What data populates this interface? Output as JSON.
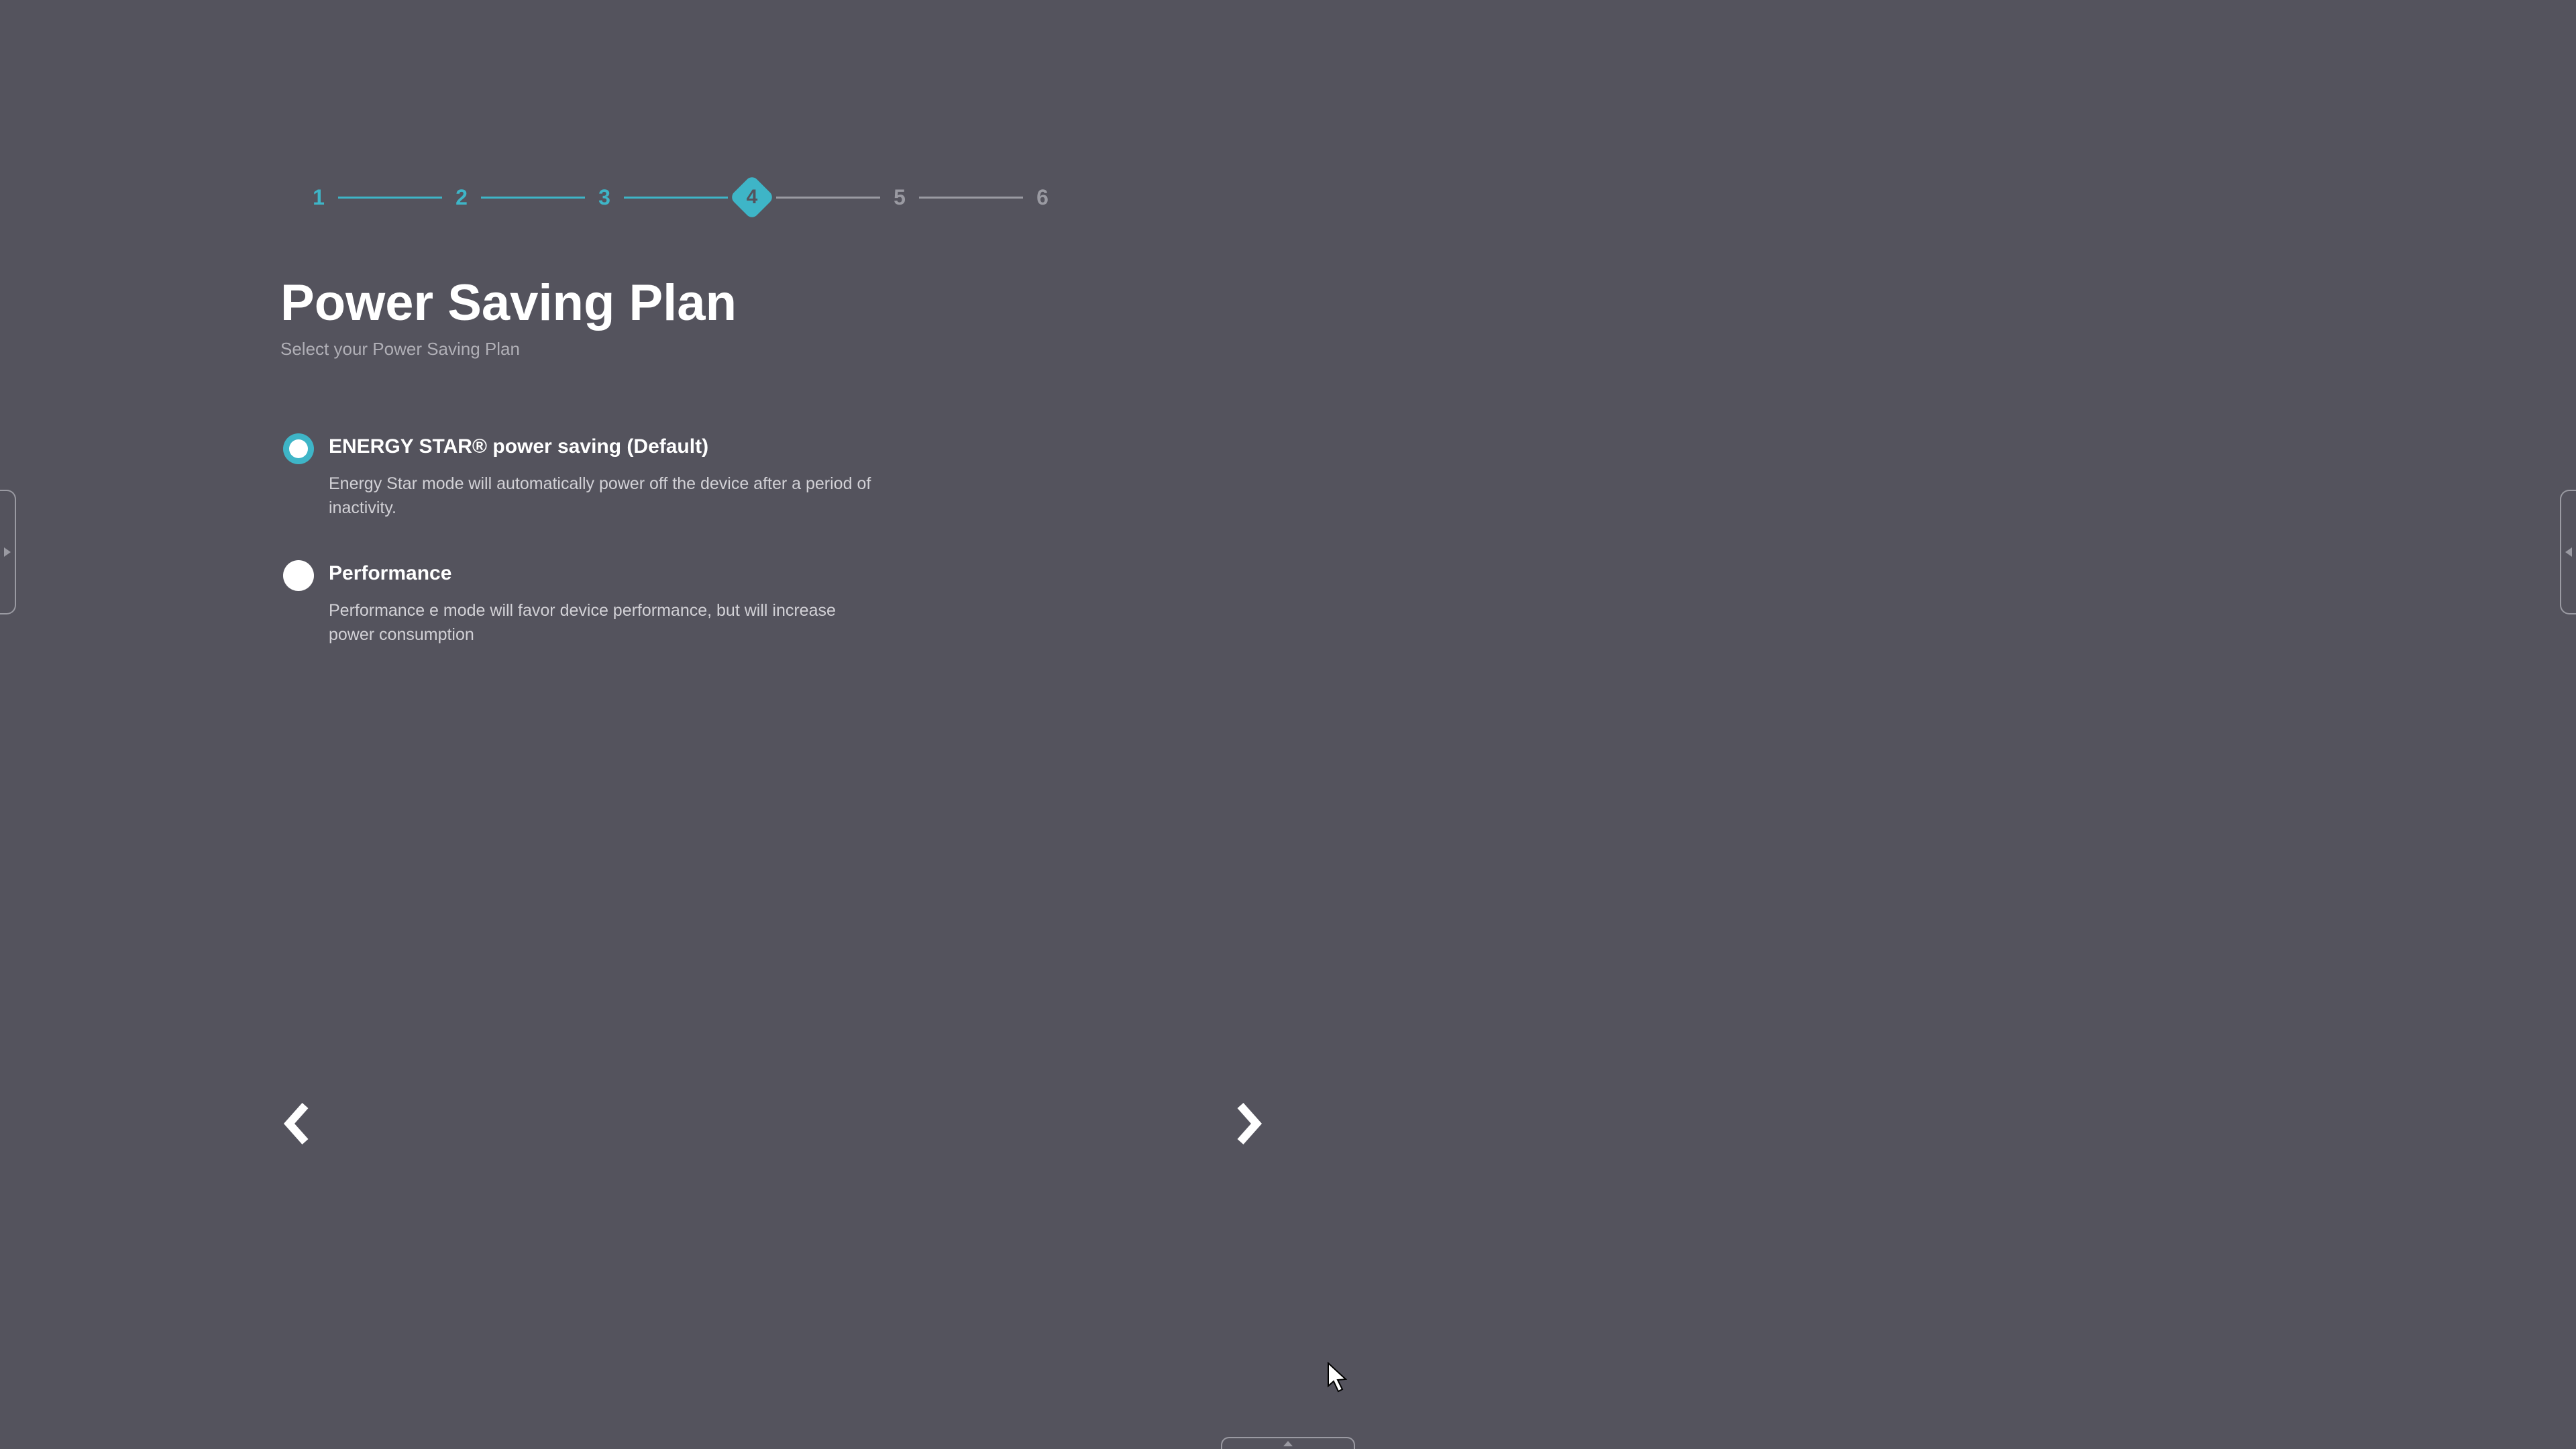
{
  "stepper": {
    "steps": [
      "1",
      "2",
      "3",
      "4",
      "5",
      "6"
    ],
    "current_index": 3
  },
  "page": {
    "title": "Power Saving Plan",
    "subtitle": "Select your Power Saving Plan"
  },
  "options": [
    {
      "label": "ENERGY STAR® power saving (Default)",
      "description": "Energy Star mode will automatically power off the device after a period of inactivity.",
      "selected": true
    },
    {
      "label": "Performance",
      "description": "Performance e mode will favor device performance, but will increase power consumption",
      "selected": false
    }
  ],
  "colors": {
    "accent": "#3eb5c7",
    "bg": "#54535d",
    "inactive": "#9a9aa2"
  }
}
